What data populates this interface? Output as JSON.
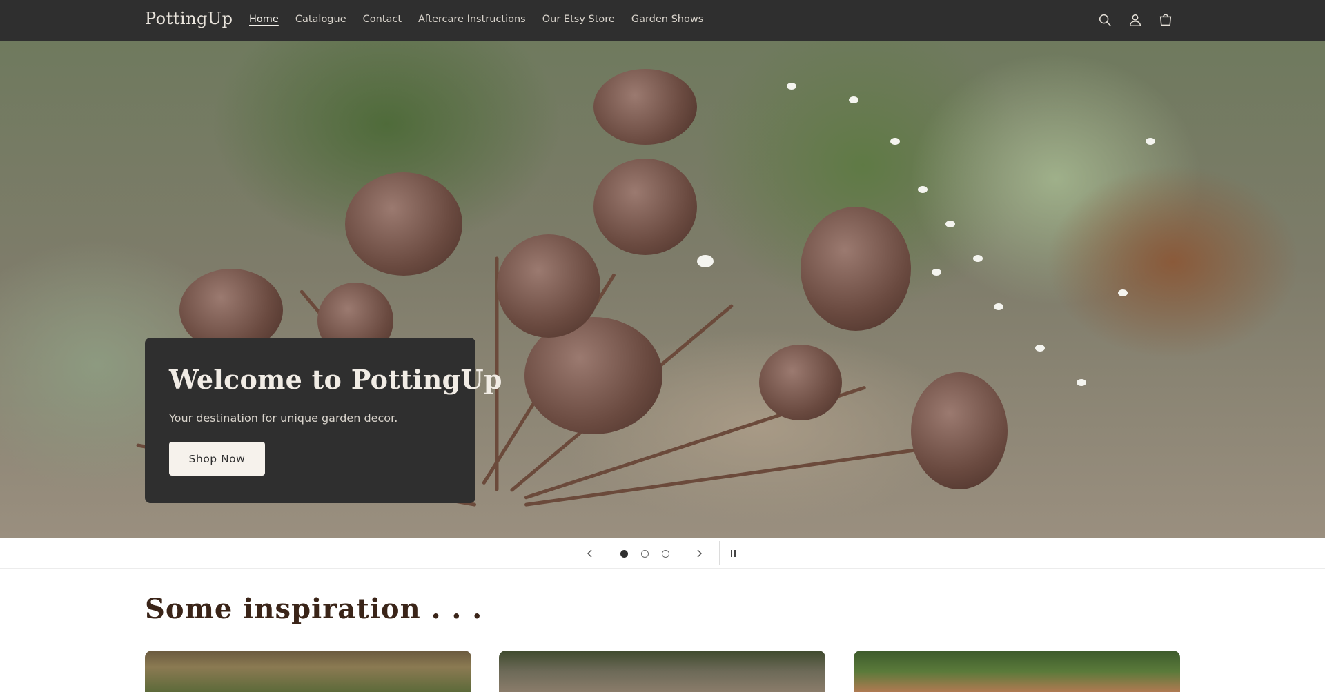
{
  "brand": {
    "name": "PottingUp"
  },
  "nav": {
    "items": [
      {
        "label": "Home",
        "active": true
      },
      {
        "label": "Catalogue",
        "active": false
      },
      {
        "label": "Contact",
        "active": false
      },
      {
        "label": "Aftercare Instructions",
        "active": false
      },
      {
        "label": "Our Etsy Store",
        "active": false
      },
      {
        "label": "Garden Shows",
        "active": false
      }
    ]
  },
  "header_icons": [
    "search-icon",
    "account-icon",
    "cart-icon"
  ],
  "hero": {
    "title": "Welcome to PottingUp",
    "subtitle": "Your destination for unique garden decor.",
    "button_label": "Shop Now"
  },
  "slideshow": {
    "slide_count": 3,
    "current_slide": 1,
    "controls": [
      "previous-icon",
      "next-icon",
      "pause-icon"
    ]
  },
  "inspiration": {
    "title": "Some inspiration . . ."
  },
  "colors": {
    "header_bg": "#2f2f2f",
    "header_text": "#d8d3cb",
    "accent_title": "#3a2418",
    "button_bg": "#f6f2ec"
  }
}
